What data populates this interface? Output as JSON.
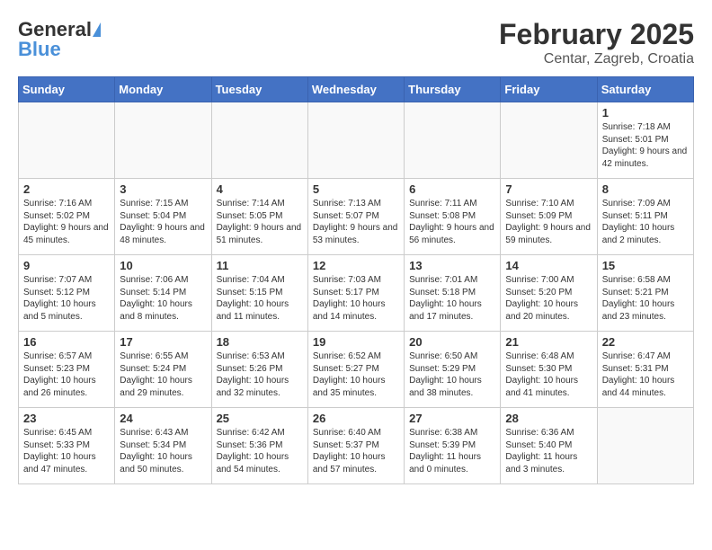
{
  "header": {
    "logo_line1": "General",
    "logo_line2": "Blue",
    "month": "February 2025",
    "location": "Centar, Zagreb, Croatia"
  },
  "weekdays": [
    "Sunday",
    "Monday",
    "Tuesday",
    "Wednesday",
    "Thursday",
    "Friday",
    "Saturday"
  ],
  "weeks": [
    [
      {
        "day": "",
        "info": ""
      },
      {
        "day": "",
        "info": ""
      },
      {
        "day": "",
        "info": ""
      },
      {
        "day": "",
        "info": ""
      },
      {
        "day": "",
        "info": ""
      },
      {
        "day": "",
        "info": ""
      },
      {
        "day": "1",
        "info": "Sunrise: 7:18 AM\nSunset: 5:01 PM\nDaylight: 9 hours and 42 minutes."
      }
    ],
    [
      {
        "day": "2",
        "info": "Sunrise: 7:16 AM\nSunset: 5:02 PM\nDaylight: 9 hours and 45 minutes."
      },
      {
        "day": "3",
        "info": "Sunrise: 7:15 AM\nSunset: 5:04 PM\nDaylight: 9 hours and 48 minutes."
      },
      {
        "day": "4",
        "info": "Sunrise: 7:14 AM\nSunset: 5:05 PM\nDaylight: 9 hours and 51 minutes."
      },
      {
        "day": "5",
        "info": "Sunrise: 7:13 AM\nSunset: 5:07 PM\nDaylight: 9 hours and 53 minutes."
      },
      {
        "day": "6",
        "info": "Sunrise: 7:11 AM\nSunset: 5:08 PM\nDaylight: 9 hours and 56 minutes."
      },
      {
        "day": "7",
        "info": "Sunrise: 7:10 AM\nSunset: 5:09 PM\nDaylight: 9 hours and 59 minutes."
      },
      {
        "day": "8",
        "info": "Sunrise: 7:09 AM\nSunset: 5:11 PM\nDaylight: 10 hours and 2 minutes."
      }
    ],
    [
      {
        "day": "9",
        "info": "Sunrise: 7:07 AM\nSunset: 5:12 PM\nDaylight: 10 hours and 5 minutes."
      },
      {
        "day": "10",
        "info": "Sunrise: 7:06 AM\nSunset: 5:14 PM\nDaylight: 10 hours and 8 minutes."
      },
      {
        "day": "11",
        "info": "Sunrise: 7:04 AM\nSunset: 5:15 PM\nDaylight: 10 hours and 11 minutes."
      },
      {
        "day": "12",
        "info": "Sunrise: 7:03 AM\nSunset: 5:17 PM\nDaylight: 10 hours and 14 minutes."
      },
      {
        "day": "13",
        "info": "Sunrise: 7:01 AM\nSunset: 5:18 PM\nDaylight: 10 hours and 17 minutes."
      },
      {
        "day": "14",
        "info": "Sunrise: 7:00 AM\nSunset: 5:20 PM\nDaylight: 10 hours and 20 minutes."
      },
      {
        "day": "15",
        "info": "Sunrise: 6:58 AM\nSunset: 5:21 PM\nDaylight: 10 hours and 23 minutes."
      }
    ],
    [
      {
        "day": "16",
        "info": "Sunrise: 6:57 AM\nSunset: 5:23 PM\nDaylight: 10 hours and 26 minutes."
      },
      {
        "day": "17",
        "info": "Sunrise: 6:55 AM\nSunset: 5:24 PM\nDaylight: 10 hours and 29 minutes."
      },
      {
        "day": "18",
        "info": "Sunrise: 6:53 AM\nSunset: 5:26 PM\nDaylight: 10 hours and 32 minutes."
      },
      {
        "day": "19",
        "info": "Sunrise: 6:52 AM\nSunset: 5:27 PM\nDaylight: 10 hours and 35 minutes."
      },
      {
        "day": "20",
        "info": "Sunrise: 6:50 AM\nSunset: 5:29 PM\nDaylight: 10 hours and 38 minutes."
      },
      {
        "day": "21",
        "info": "Sunrise: 6:48 AM\nSunset: 5:30 PM\nDaylight: 10 hours and 41 minutes."
      },
      {
        "day": "22",
        "info": "Sunrise: 6:47 AM\nSunset: 5:31 PM\nDaylight: 10 hours and 44 minutes."
      }
    ],
    [
      {
        "day": "23",
        "info": "Sunrise: 6:45 AM\nSunset: 5:33 PM\nDaylight: 10 hours and 47 minutes."
      },
      {
        "day": "24",
        "info": "Sunrise: 6:43 AM\nSunset: 5:34 PM\nDaylight: 10 hours and 50 minutes."
      },
      {
        "day": "25",
        "info": "Sunrise: 6:42 AM\nSunset: 5:36 PM\nDaylight: 10 hours and 54 minutes."
      },
      {
        "day": "26",
        "info": "Sunrise: 6:40 AM\nSunset: 5:37 PM\nDaylight: 10 hours and 57 minutes."
      },
      {
        "day": "27",
        "info": "Sunrise: 6:38 AM\nSunset: 5:39 PM\nDaylight: 11 hours and 0 minutes."
      },
      {
        "day": "28",
        "info": "Sunrise: 6:36 AM\nSunset: 5:40 PM\nDaylight: 11 hours and 3 minutes."
      },
      {
        "day": "",
        "info": ""
      }
    ]
  ]
}
